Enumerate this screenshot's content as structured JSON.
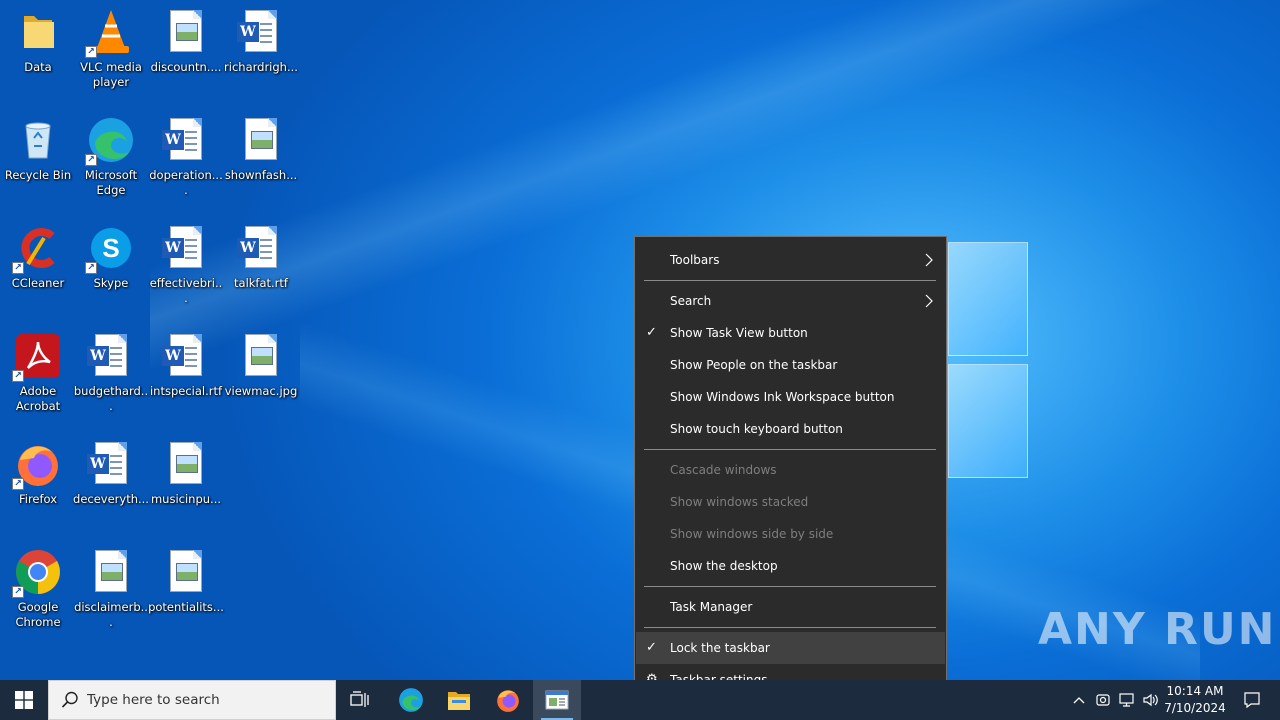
{
  "desktop": {
    "icons": [
      {
        "label": "Data",
        "kind": "folder"
      },
      {
        "label": "Recycle Bin",
        "kind": "recycle-bin"
      },
      {
        "label": "CCleaner",
        "kind": "ccleaner"
      },
      {
        "label": "Adobe Acrobat",
        "kind": "acrobat"
      },
      {
        "label": "Firefox",
        "kind": "firefox"
      },
      {
        "label": "Google Chrome",
        "kind": "chrome"
      },
      {
        "label": "VLC media player",
        "kind": "vlc"
      },
      {
        "label": "Microsoft Edge",
        "kind": "edge"
      },
      {
        "label": "Skype",
        "kind": "skype"
      },
      {
        "label": "budgethard...",
        "kind": "word-doc"
      },
      {
        "label": "deceveryth...",
        "kind": "word-doc"
      },
      {
        "label": "disclaimerb...",
        "kind": "image-file"
      },
      {
        "label": "discountn....",
        "kind": "image-file"
      },
      {
        "label": "doperation....",
        "kind": "word-doc"
      },
      {
        "label": "effectivebri...",
        "kind": "word-doc"
      },
      {
        "label": "intspecial.rtf",
        "kind": "word-doc"
      },
      {
        "label": "musicinpu...",
        "kind": "image-file"
      },
      {
        "label": "potentialits...",
        "kind": "image-file"
      },
      {
        "label": "richardrigh...",
        "kind": "word-doc"
      },
      {
        "label": "shownfash...",
        "kind": "image-file"
      },
      {
        "label": "talkfat.rtf",
        "kind": "word-doc"
      },
      {
        "label": "viewmac.jpg",
        "kind": "image-file"
      }
    ]
  },
  "context_menu": {
    "items": [
      {
        "label": "Toolbars",
        "submenu": true
      },
      {
        "label": "Search",
        "submenu": true
      },
      {
        "label": "Show Task View button",
        "checked": true
      },
      {
        "label": "Show People on the taskbar"
      },
      {
        "label": "Show Windows Ink Workspace button"
      },
      {
        "label": "Show touch keyboard button"
      },
      {
        "label": "Cascade windows",
        "disabled": true
      },
      {
        "label": "Show windows stacked",
        "disabled": true
      },
      {
        "label": "Show windows side by side",
        "disabled": true
      },
      {
        "label": "Show the desktop"
      },
      {
        "label": "Task Manager"
      },
      {
        "label": "Lock the taskbar",
        "checked": true,
        "highlighted": true
      },
      {
        "label": "Taskbar settings",
        "icon": "gear-icon"
      }
    ]
  },
  "taskbar": {
    "search_placeholder": "Type here to search",
    "pinned": [
      "task-view-icon",
      "edge-icon",
      "file-explorer-icon",
      "firefox-icon",
      "active-window-icon"
    ],
    "clock_time": "10:14 AM",
    "clock_date": "7/10/2024"
  },
  "watermark": "ANY RUN",
  "colors": {
    "menu_bg": "#2b2b2b",
    "menu_hover": "#414141",
    "taskbar_bg": "#1c2c3e",
    "accent": "#0a6ed6"
  }
}
